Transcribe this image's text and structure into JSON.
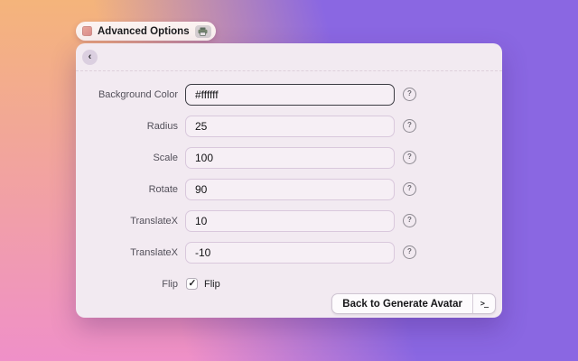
{
  "badge": {
    "label": "Advanced Options"
  },
  "panel": {
    "back_glyph": "‹",
    "help_glyph": "?",
    "fields": [
      {
        "label": "Background Color",
        "value": "#ffffff"
      },
      {
        "label": "Radius",
        "value": "25"
      },
      {
        "label": "Scale",
        "value": "100"
      },
      {
        "label": "Rotate",
        "value": "90"
      },
      {
        "label": "TranslateX",
        "value": "10"
      },
      {
        "label": "TranslateX",
        "value": "-10"
      }
    ],
    "flip": {
      "label": "Flip",
      "checkbox_label": "Flip",
      "checked": "checked"
    },
    "footer": {
      "button_label": "Back to Generate Avatar",
      "terminal_glyph": ">_"
    }
  },
  "colors": {
    "bg_orange": "#f4b47b",
    "bg_pink": "#ef90c8",
    "bg_purple": "#8a67e2",
    "pill_bg": "#fbf2f0",
    "card_bg": "#f2eaf1",
    "circle_btn_bg": "#dbcfe0",
    "input_border": "#d9c8dc",
    "input_border_focus": "#3c3c43",
    "label_color": "#53505a",
    "value_color": "#121214",
    "button_border": "#cfc5d2"
  }
}
